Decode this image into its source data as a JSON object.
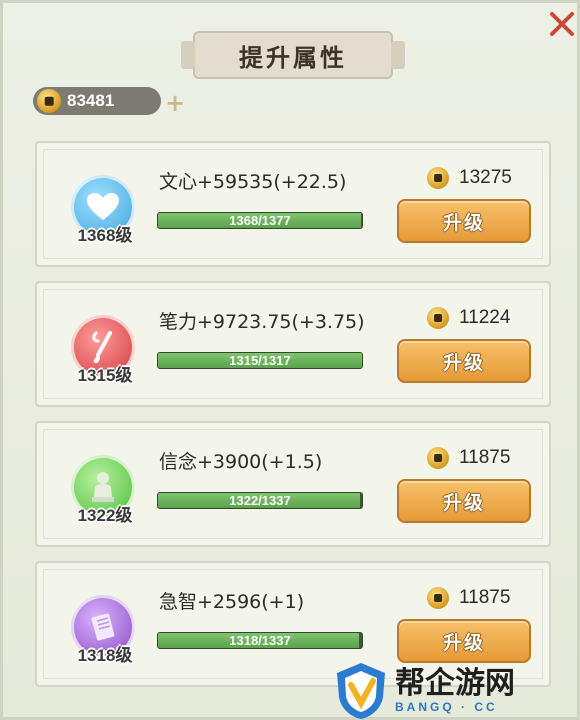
{
  "title": "提升属性",
  "currency": {
    "icon": "coin-icon",
    "value": "83481"
  },
  "attributes": [
    {
      "name": "文心+59535(+22.5)",
      "level": "1368级",
      "progress": {
        "current": 1368,
        "max": 1377,
        "text": "1368/1377"
      },
      "cost": "13275",
      "button": "升级",
      "icon": "heart-icon",
      "color": "#5fb8e8"
    },
    {
      "name": "笔力+9723.75(+3.75)",
      "level": "1315级",
      "progress": {
        "current": 1315,
        "max": 1317,
        "text": "1315/1317"
      },
      "cost": "11224",
      "button": "升级",
      "icon": "brush-icon",
      "color": "#e05a5a"
    },
    {
      "name": "信念+3900(+1.5)",
      "level": "1322级",
      "progress": {
        "current": 1322,
        "max": 1337,
        "text": "1322/1337"
      },
      "cost": "11875",
      "button": "升级",
      "icon": "statue-icon",
      "color": "#6fcf5a"
    },
    {
      "name": "急智+2596(+1)",
      "level": "1318级",
      "progress": {
        "current": 1318,
        "max": 1337,
        "text": "1318/1337"
      },
      "cost": "11875",
      "button": "升级",
      "icon": "scroll-icon",
      "color": "#a36cd6"
    }
  ],
  "watermark": {
    "text": "帮企游网",
    "sub": "BANGQ · CC",
    "icon": "shield-logo-icon"
  }
}
